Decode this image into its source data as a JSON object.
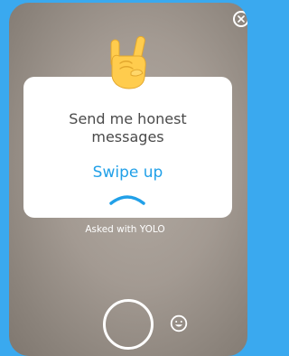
{
  "app": {
    "background_color": "#3aa9ef"
  },
  "story": {
    "close_icon": "close-icon",
    "emoji": "sign-of-the-horns-emoji",
    "card": {
      "title": "Send me honest messages",
      "cta": "Swipe up",
      "chevron_icon": "chevron-up-icon",
      "cta_color": "#21a0e8"
    },
    "caption": "Asked with YOLO",
    "shutter_icon": "camera-shutter-button",
    "smiley_icon": "smiley-face-icon"
  }
}
